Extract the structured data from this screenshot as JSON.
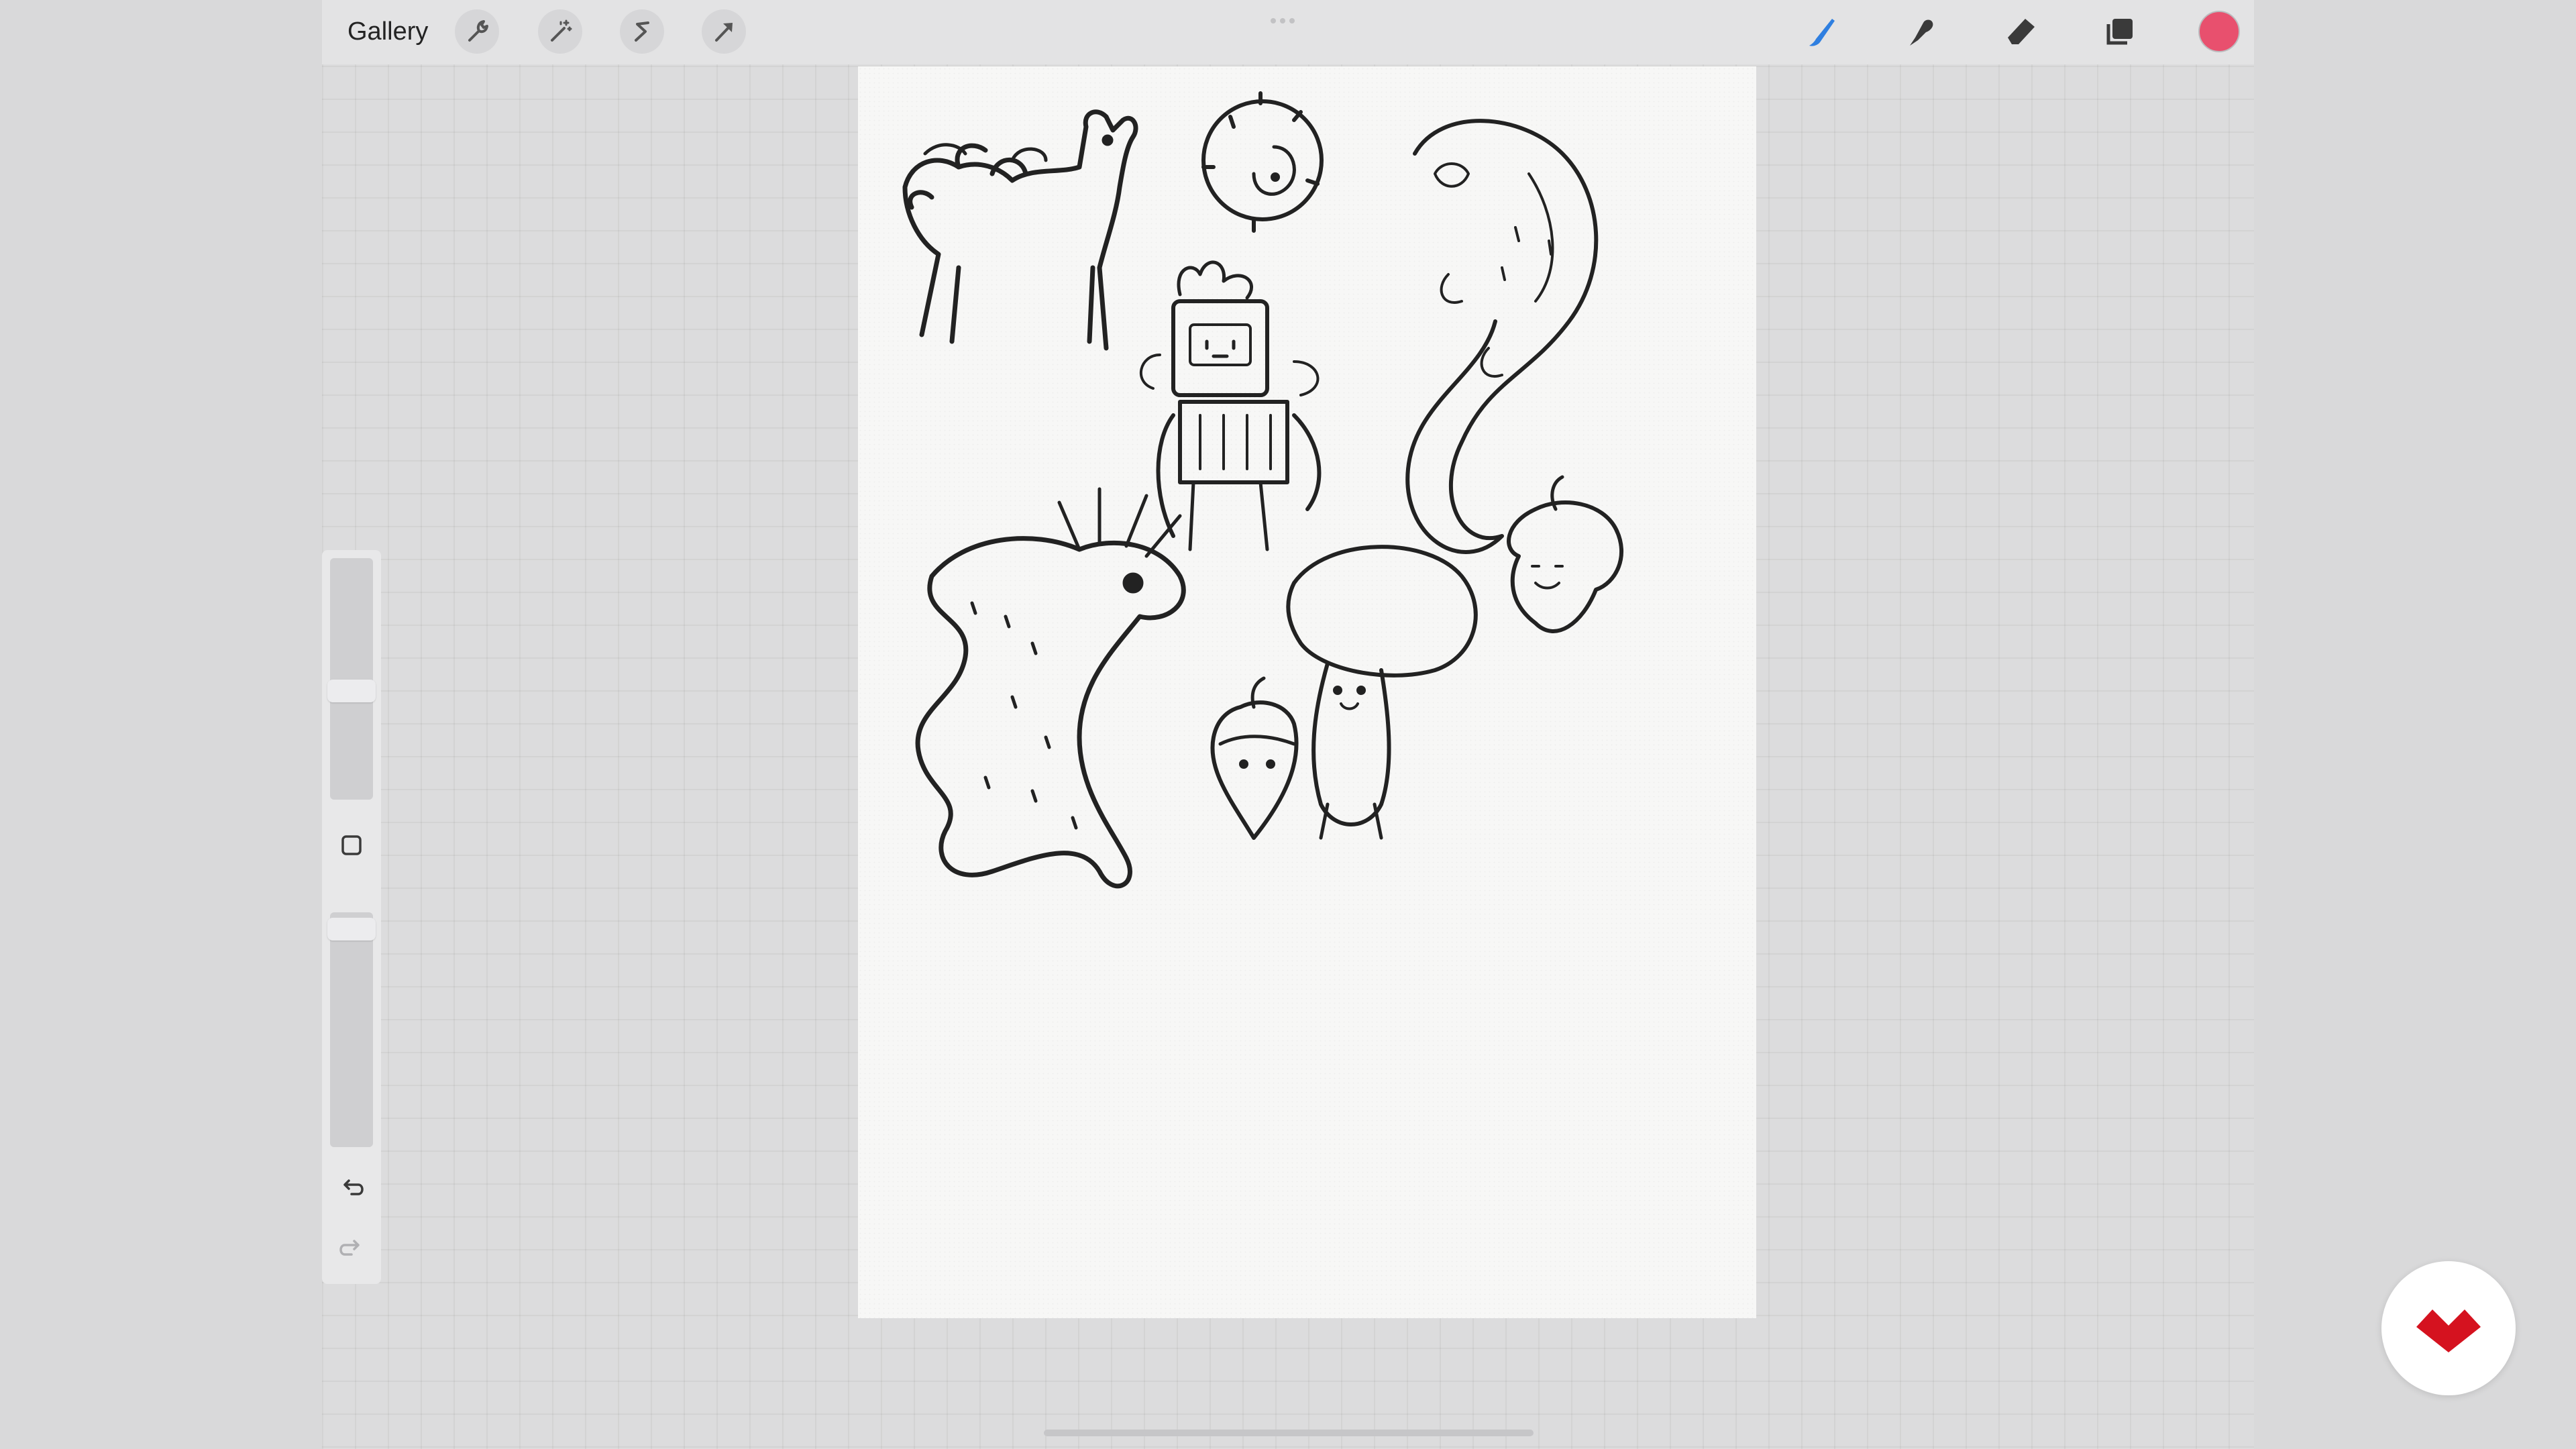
{
  "topbar": {
    "gallery_label": "Gallery",
    "left_icons": [
      "wrench-icon",
      "magic-wand-icon",
      "selection-s-icon",
      "transform-arrow-icon"
    ],
    "right_icons": [
      "brush-icon",
      "smudge-icon",
      "eraser-icon",
      "layers-icon"
    ],
    "active_color": "#e8506e",
    "active_tool": "brush",
    "active_tool_color": "#2f7fe0"
  },
  "sidebar": {
    "brush_size_level": 0.45,
    "opacity_level": 0.05,
    "icons": [
      "modify-square-icon",
      "undo-icon",
      "redo-icon"
    ]
  },
  "canvas": {
    "sketches": [
      "deer",
      "cactus-ball",
      "ghost-spirit",
      "robot",
      "axolotl",
      "acorn",
      "mushroom",
      "acorn-character"
    ]
  },
  "brand_badge": {
    "icon": "brand-logo-icon",
    "color": "#d5121f"
  }
}
